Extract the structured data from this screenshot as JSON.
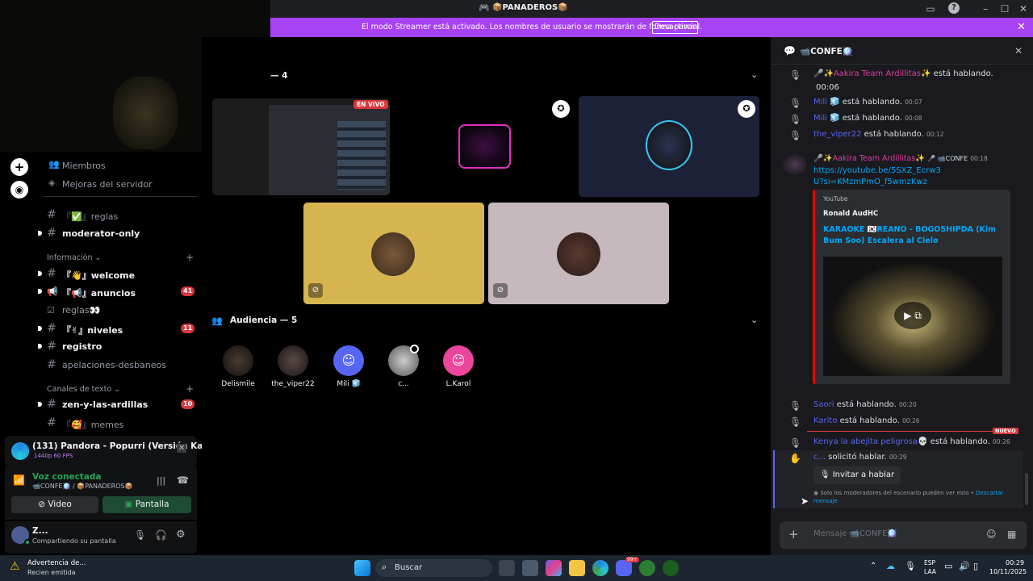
{
  "window": {
    "title": "📦PANADEROS📦"
  },
  "banner": {
    "text": "El modo Streamer está activado. Los nombres de usuario se mostrarán de forma parcial.",
    "button": "Desactivar"
  },
  "stage": {
    "speakers_count": "— 4",
    "live_badge": "EN VIVO",
    "audience_title": "Audiencia — 5",
    "audience": [
      "Delismile",
      "the_viper22",
      "Mili 🧊",
      "c...",
      "L.Karol"
    ]
  },
  "server_menu": {
    "members": "Miembros",
    "boost": "Mejoras del servidor"
  },
  "channels": {
    "ch1": "『✅』reglas",
    "ch2": "moderator-only",
    "cat_info": "Información",
    "ch3": "『👋』welcome",
    "ch4": "『📢』anuncios",
    "ch4_badge": "41",
    "ch5": "reglas👀",
    "ch6": "『✌』niveles",
    "ch6_badge": "11",
    "ch7": "registro",
    "ch8": "apelaciones-desbaneos",
    "cat_text": "Canales de texto",
    "ch9": "zen-y-las-ardillas",
    "ch9_badge": "10",
    "ch10": "『🥰』memes"
  },
  "activity": {
    "title": "(131) Pandora - Popurri (Versión Kar...",
    "sub": "1440p 60 FPS"
  },
  "voice": {
    "status": "Voz conectada",
    "location": "📹CONFE🪩 / 📦PANADEROS📦",
    "video_btn": "Video",
    "screen_btn": "Pantalla"
  },
  "user": {
    "name": "Z...",
    "status": "Compartiendo su pantalla"
  },
  "chat": {
    "header": "📹CONFE🪩",
    "speaking": "está hablando.",
    "m1_user": "🎤✨Aakira Team Ardillitas✨",
    "m1_time": "00:06",
    "m2_user": "Mili 🧊",
    "m2_time": "00:07",
    "m3_user": "Mili 🧊",
    "m3_time": "00:08",
    "m4_user": "the_viper22",
    "m4_time": "00:12",
    "post_user": "🎤✨Aakira Team Ardillitas✨",
    "post_tag": "🎤 📹CONFE",
    "post_time": "00:18",
    "post_link": "https://youtube.be/5SXZ_Ecrw3U?si=KMzmPmO_f5wmzKwz",
    "embed_provider": "YouTube",
    "embed_author": "Ronald AudHC",
    "embed_title": "KARAOKE 🇰🇷REANO - BOGOSHIPDA (Kim Bum Soo) Escalera al Cielo",
    "m5_user": "Saori",
    "m5_time": "00:20",
    "m6_user": "Karito",
    "m6_time": "00:26",
    "new_label": "NUEVO",
    "m7_user": "Kenya la abejita peligrosa💀",
    "m7_time": "00:26",
    "m8_user": "c...",
    "m8_text": "solicitó hablar.",
    "m8_time": "00:29",
    "invite_btn": "Invitar a hablar",
    "mod_note": "Solo los moderadores del escenario pueden ver esto • ",
    "dismiss": "Descartar mensaje",
    "input_placeholder": "Mensaje 📹CONFE🪩"
  },
  "taskbar": {
    "notif_title": "Advertencia de...",
    "notif_sub": "Recien emitida",
    "search": "Buscar",
    "lang1": "ESP",
    "lang2": "LAA",
    "time": "00:29",
    "date": "10/11/2025",
    "discord_badge": "99+"
  },
  "colors": {
    "accent": "#a742f5",
    "blurple": "#5865f2",
    "green": "#23a559",
    "red": "#da373c"
  }
}
